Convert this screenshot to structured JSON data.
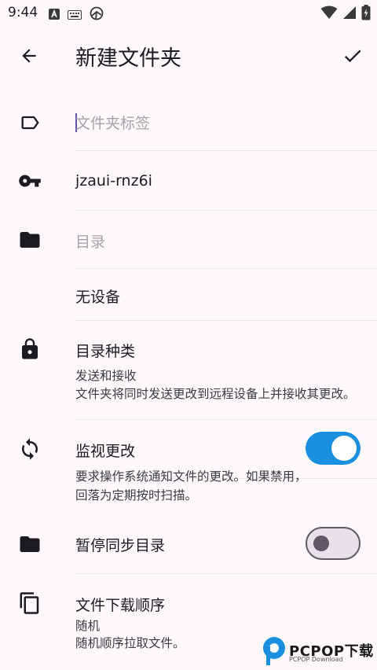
{
  "status_bar": {
    "time": "9:44",
    "left_icons": [
      "text-a-icon",
      "keyboard-icon",
      "sync-app-icon"
    ],
    "right_icons": [
      "wifi-icon",
      "signal-icon",
      "battery-charging-icon"
    ]
  },
  "app_bar": {
    "title": "新建文件夹",
    "back_icon": "arrow-left-icon",
    "confirm_icon": "check-icon"
  },
  "fields": {
    "label": {
      "value": "",
      "placeholder": "文件夹标签"
    },
    "folder_id": {
      "value": "jzaui-rnz6i"
    },
    "directory": {
      "value": "",
      "placeholder": "目录"
    },
    "devices": {
      "value": "无设备"
    }
  },
  "settings": {
    "folder_type": {
      "title": "目录种类",
      "value": "发送和接收",
      "description": "文件夹将同时发送更改到远程设备上并接收其更改。"
    },
    "watch_changes": {
      "title": "监视更改",
      "description_line1": "要求操作系统通知文件的更改。如果禁用，",
      "description_line2": "回落为定期按时扫描。",
      "enabled": true
    },
    "pause_sync": {
      "title": "暂停同步目录",
      "enabled": false
    },
    "pull_order": {
      "title": "文件下载顺序",
      "value": "随机",
      "description": "随机顺序拉取文件。"
    }
  },
  "colors": {
    "accent": "#1a8fe0",
    "background": "#fdf8fb",
    "caret": "#6750a4"
  },
  "watermark": {
    "text": "PCPOP下载",
    "sub": "PCPOP Download"
  }
}
